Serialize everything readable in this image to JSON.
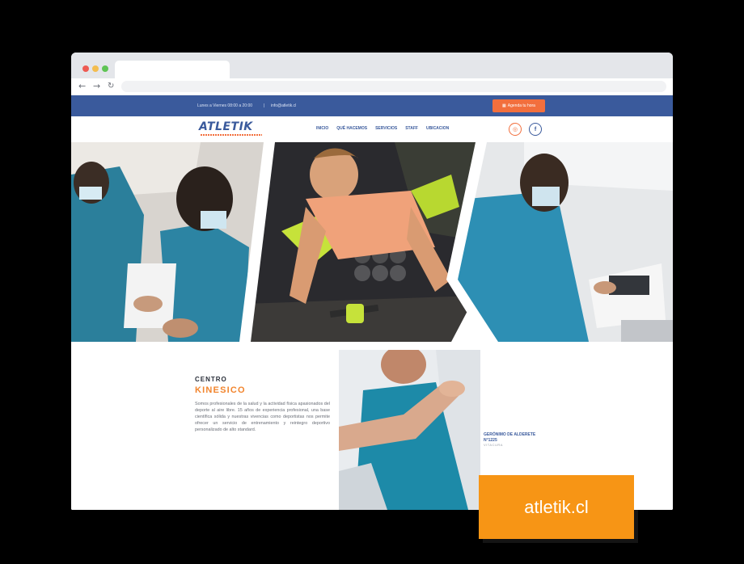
{
  "browser": {
    "tab_title": "",
    "url": ""
  },
  "topbar": {
    "hours": "Lunes a Viernes 08:00 a 20:00",
    "separator": "|",
    "email": "info@atletik.cl",
    "cta_label": "Agenda tu hora",
    "cta_icon": "calendar-icon"
  },
  "header": {
    "logo": "ATLETIK",
    "menu": [
      "INICIO",
      "QUÉ HACEMOS",
      "SERVICIOS",
      "STAFF",
      "UBICACION"
    ],
    "social": [
      {
        "name": "instagram-icon",
        "glyph": "◎"
      },
      {
        "name": "facebook-icon",
        "glyph": "f"
      }
    ]
  },
  "section": {
    "kicker": "CENTRO",
    "headline": "KINESICO",
    "paragraph": "Somos profesionales de la salud y la actividad física apasionados del deporte al aire libre. 15 años de experiencia profesional, una base científica sólida y nuestras vivencias como deportistas nos permite ofrecer un servicio de entrenamiento y reintegro deportivo personalizado de alto standard.",
    "address_line1": "GERÓNIMO DE ALDERETE",
    "address_line2": "N°1225",
    "address_sub": "VITACURA"
  },
  "badge": {
    "label": "atletik.cl"
  },
  "colors": {
    "brand_blue": "#3a5a9c",
    "brand_orange": "#f26f3d",
    "badge_orange": "#f79515"
  }
}
